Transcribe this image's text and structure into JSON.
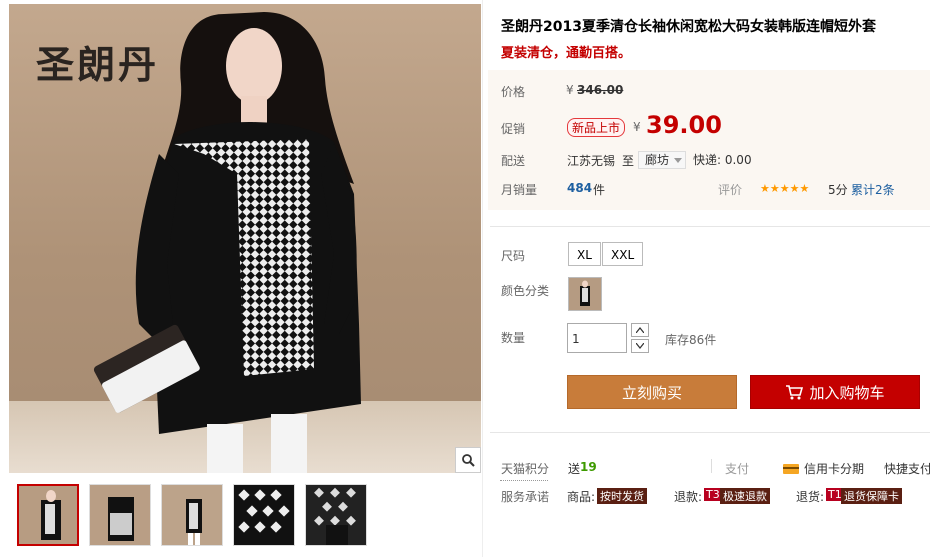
{
  "gallery": {
    "brand_logo": "圣朗丹",
    "zoom_icon": "magnifier-icon",
    "thumb_count": 5
  },
  "product": {
    "title": "圣朗丹2013夏季清仓长袖休闲宽松大码女装韩版连帽短外套",
    "subtitle": "夏装清仓，通勤百搭。",
    "price_label": "价格",
    "currency": "¥",
    "original_price": "346.00",
    "promo_label": "促销",
    "promo_tag": "新品上市",
    "promo_price": "39.00",
    "shipping_label": "配送",
    "ship_from": "江苏无锡",
    "ship_to_word": "至",
    "ship_to": "廊坊",
    "express": "快递: 0.00",
    "monthly_sales_label": "月销量",
    "monthly_sales": "484",
    "monthly_sales_unit": "件",
    "rating_label": "评价",
    "stars": "★★★★★",
    "rating_score": "5分",
    "reviews": "累计2条"
  },
  "options": {
    "size_label": "尺码",
    "sizes": [
      "XL",
      "XXL"
    ],
    "color_label": "颜色分类",
    "quantity_label": "数量",
    "quantity_value": "1",
    "stock": "库存86件"
  },
  "actions": {
    "buy_now": "立刻购买",
    "add_to_cart": "加入购物车"
  },
  "services": {
    "points_label": "天猫积分",
    "points_prefix": "送",
    "points_value": "19",
    "payment_label": "支付",
    "credit_installment": "信用卡分期",
    "express_pay": "快捷支付",
    "promise_label": "服务承诺",
    "goods_label": "商品:",
    "goods_badge": "按时发货",
    "refund_label": "退款:",
    "refund_badge_code": "T3",
    "refund_badge": "极速退款",
    "return_label": "退货:",
    "return_badge_code": "T1",
    "return_badge": "退货保障卡"
  },
  "colors": {
    "accent_red": "#c40000",
    "buy_orange": "#c87c3a",
    "points_green": "#3d9a00",
    "sales_blue": "#1d5fa0"
  }
}
